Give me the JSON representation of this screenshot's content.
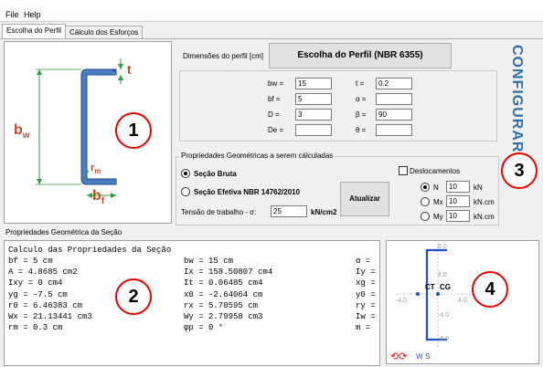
{
  "menu": {
    "file": "File",
    "help": "Help"
  },
  "tabs": [
    {
      "label": "Escolha do Perfil"
    },
    {
      "label": "Cálculo dos Esforços"
    }
  ],
  "section_figure": {
    "label_t": "t",
    "label_bw": "b",
    "label_bw_sub": "w",
    "label_rm": "r",
    "label_rm_sub": "m",
    "label_bf": "b",
    "label_bf_sub": "f"
  },
  "dims": {
    "caption": "Dimensões do perfil [cm]",
    "title": "Escolha do Perfil (NBR 6355)",
    "fields": [
      {
        "label": "bw =",
        "value": "15"
      },
      {
        "label": "bf =",
        "value": "5"
      },
      {
        "label": "D =",
        "value": "3"
      },
      {
        "label": "De =",
        "value": ""
      },
      {
        "label": "t =",
        "value": "0.2"
      },
      {
        "label": "α =",
        "value": ""
      },
      {
        "label": "β =",
        "value": "90"
      },
      {
        "label": "θ =",
        "value": ""
      }
    ]
  },
  "configurar": "CONFIGURAR",
  "geom": {
    "group_title": "Propriedades Geométricas a serem cálculadas",
    "radio_bruta": "Seção Bruta",
    "radio_efetiva": "Seção Efetiva NBR 14762/2010",
    "tensao_label": "Tensão de trabalho - σ:",
    "tensao_value": "25",
    "tensao_unit": "kN/cm2",
    "atualizar": "Atualizar",
    "deslocamentos": "Deslocamentos",
    "loads": [
      {
        "label": "N",
        "value": "10",
        "unit": "kN"
      },
      {
        "label": "Mx",
        "value": "10",
        "unit": "kN.cm"
      },
      {
        "label": "My",
        "value": "10",
        "unit": "kN.cm"
      }
    ]
  },
  "results": {
    "group_title": "Propriedades Geométrica da Seção",
    "heading": "Calculo das Propriedades da Seção",
    "col1": [
      "bf = 5 cm",
      "A = 4.8685 cm2",
      "Ixy = 0 cm4",
      "yg = -7.5 cm",
      "r0 = 6.46383 cm",
      "Wx = 21.13441 cm3",
      "rm = 0.3 cm"
    ],
    "col2": [
      "bw = 15 cm",
      "Ix = 158.50807 cm4",
      "It = 0.06485 cm4",
      "x0 = -2.64064 cm",
      "rx = 5.70595 cm",
      "Wy = 2.79958 cm3",
      "φp = 0 °"
    ],
    "col3": [
      "α =",
      "Iy =",
      "xg =",
      "y0 =",
      "ry =",
      "Iw =",
      "m ="
    ]
  },
  "plot": {
    "y_ticks": [
      "8.0",
      "4.0",
      "-4.0",
      "-8.0"
    ],
    "x_ticks": [
      "-4.0",
      "4.0"
    ],
    "ct": "CT",
    "cg": "CG",
    "footer_w": "W",
    "footer_s": "S"
  },
  "callouts": [
    "1",
    "2",
    "3",
    "4"
  ]
}
